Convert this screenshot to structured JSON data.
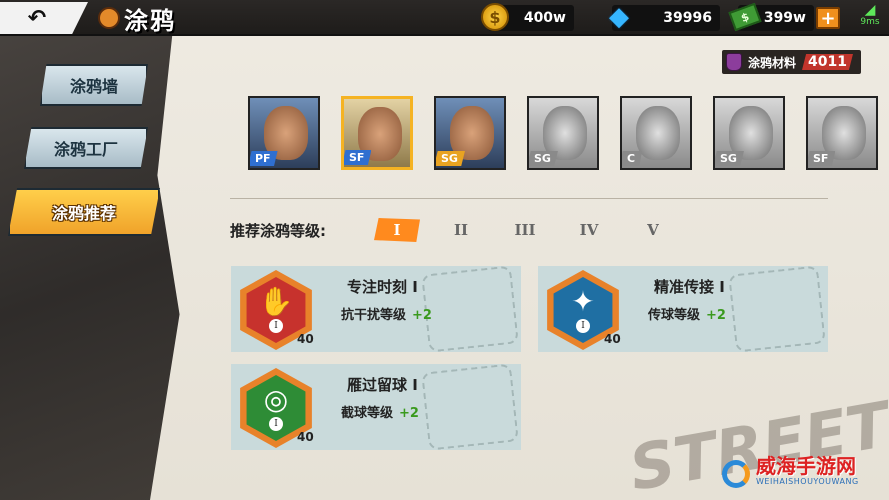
{
  "header": {
    "back_icon": "back-arrow-icon",
    "title": "涂鸦"
  },
  "resources": {
    "coins": "400w",
    "diamonds": "39996",
    "cash": "399w",
    "ping": "9ms"
  },
  "material": {
    "label": "涂鸦材料",
    "value": "4011"
  },
  "sidebar": {
    "tabs": [
      {
        "label": "涂鸦墙",
        "active": false
      },
      {
        "label": "涂鸦工厂",
        "active": false
      },
      {
        "label": "涂鸦推荐",
        "active": true
      }
    ]
  },
  "characters": [
    {
      "position": "PF",
      "pos_color": "#2f6fd0",
      "selected": false,
      "color": true
    },
    {
      "position": "SF",
      "pos_color": "#2f6fd0",
      "selected": true,
      "color": true
    },
    {
      "position": "SG",
      "pos_color": "#e9a321",
      "selected": false,
      "color": true
    },
    {
      "position": "SG",
      "pos_color": "#8a8a8a",
      "selected": false,
      "color": false
    },
    {
      "position": "C",
      "pos_color": "#8a8a8a",
      "selected": false,
      "color": false
    },
    {
      "position": "SG",
      "pos_color": "#8a8a8a",
      "selected": false,
      "color": false
    },
    {
      "position": "SF",
      "pos_color": "#8a8a8a",
      "selected": false,
      "color": false
    }
  ],
  "levels": {
    "label": "推荐涂鸦等级:",
    "tabs": [
      "I",
      "II",
      "III",
      "IV",
      "V"
    ],
    "active_index": 0
  },
  "cards": [
    {
      "name": "专注时刻 I",
      "stat": "抗干扰等级",
      "bonus": "+2",
      "level": "40",
      "rank": "I",
      "color": "#c7322d",
      "icon": "shooting-player-icon"
    },
    {
      "name": "精准传接 I",
      "stat": "传球等级",
      "bonus": "+2",
      "level": "40",
      "rank": "I",
      "color": "#1f6fa3",
      "icon": "ball-pass-icon"
    },
    {
      "name": "雁过留球 I",
      "stat": "截球等级",
      "bonus": "+2",
      "level": "40",
      "rank": "I",
      "color": "#2e8c36",
      "icon": "ball-steal-icon"
    }
  ],
  "watermark": {
    "cn": "威海手游网",
    "en": "WEIHAISHOUYOUWANG"
  }
}
